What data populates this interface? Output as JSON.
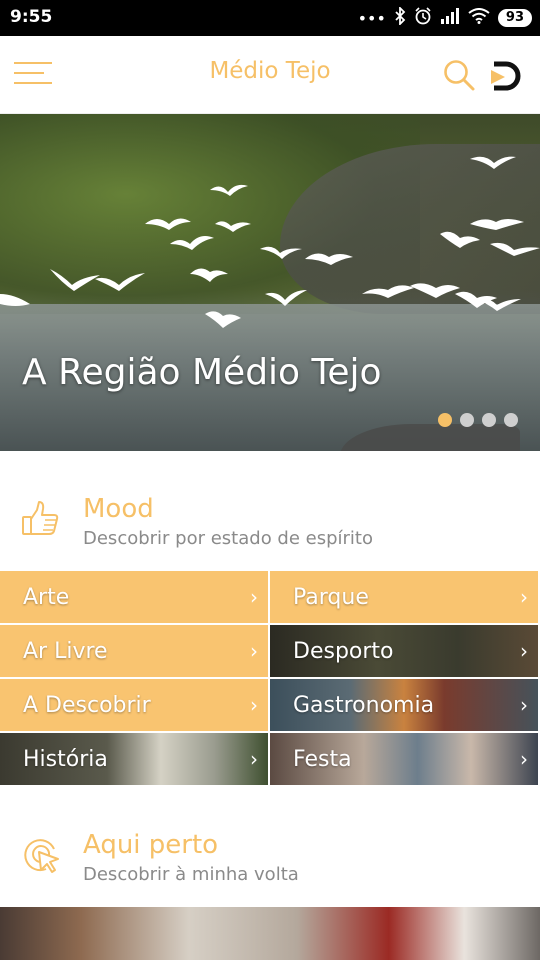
{
  "status_bar": {
    "time": "9:55",
    "icons": [
      "more-dots-icon",
      "bluetooth-icon",
      "alarm-icon",
      "signal-icon",
      "wifi-icon"
    ],
    "battery": "93"
  },
  "app_bar": {
    "title": "Médio Tejo",
    "icons": [
      "menu-icon",
      "search-icon",
      "brand-logo-icon"
    ]
  },
  "hero": {
    "caption": "A Região Médio Tejo",
    "slides_total": 4,
    "active_slide": 1
  },
  "mood_section": {
    "title": "Mood",
    "subtitle": "Descobrir por estado de espírito",
    "icon": "thumbs-up-icon"
  },
  "mood_tiles": [
    {
      "label": "Arte"
    },
    {
      "label": "Parque"
    },
    {
      "label": "Ar Livre"
    },
    {
      "label": "Desporto"
    },
    {
      "label": "A Descobrir"
    },
    {
      "label": "Gastronomia"
    },
    {
      "label": "História"
    },
    {
      "label": "Festa"
    }
  ],
  "nearby_section": {
    "title": "Aqui perto",
    "subtitle": "Descobrir à minha volta",
    "icon": "location-pointer-icon"
  },
  "colors": {
    "accent": "#f6c067",
    "tile": "#f9c470",
    "subtitle_text": "#8a8a8a"
  }
}
